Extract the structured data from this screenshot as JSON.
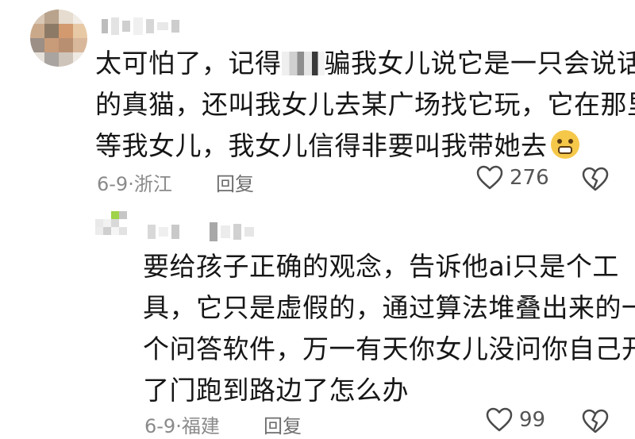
{
  "comments": [
    {
      "text_lines": [
        "太可怕了，记得",
        "骗我女儿说它是一只会说话",
        "的真猫，还叫我女儿去某广场找它玩，它在那里",
        "等我女儿，我女儿信得非要叫我带她去"
      ],
      "emoji": "astonished-face-emoji",
      "date_region": "6-9·浙江",
      "reply_label": "回复",
      "likes": "276"
    },
    {
      "text_lines": [
        "要给孩子正确的观念，告诉他ai只是个工",
        "具，它只是虚假的，通过算法堆叠出来的一",
        "个问答软件，万一有天你女儿没问你自己开",
        "了门跑到路边了怎么办"
      ],
      "date_region": "6-9·福建",
      "reply_label": "回复",
      "likes": "99"
    }
  ],
  "colors": {
    "text": "#161616",
    "meta": "#8a8a8a",
    "icon_stroke": "#4a4a4a"
  }
}
